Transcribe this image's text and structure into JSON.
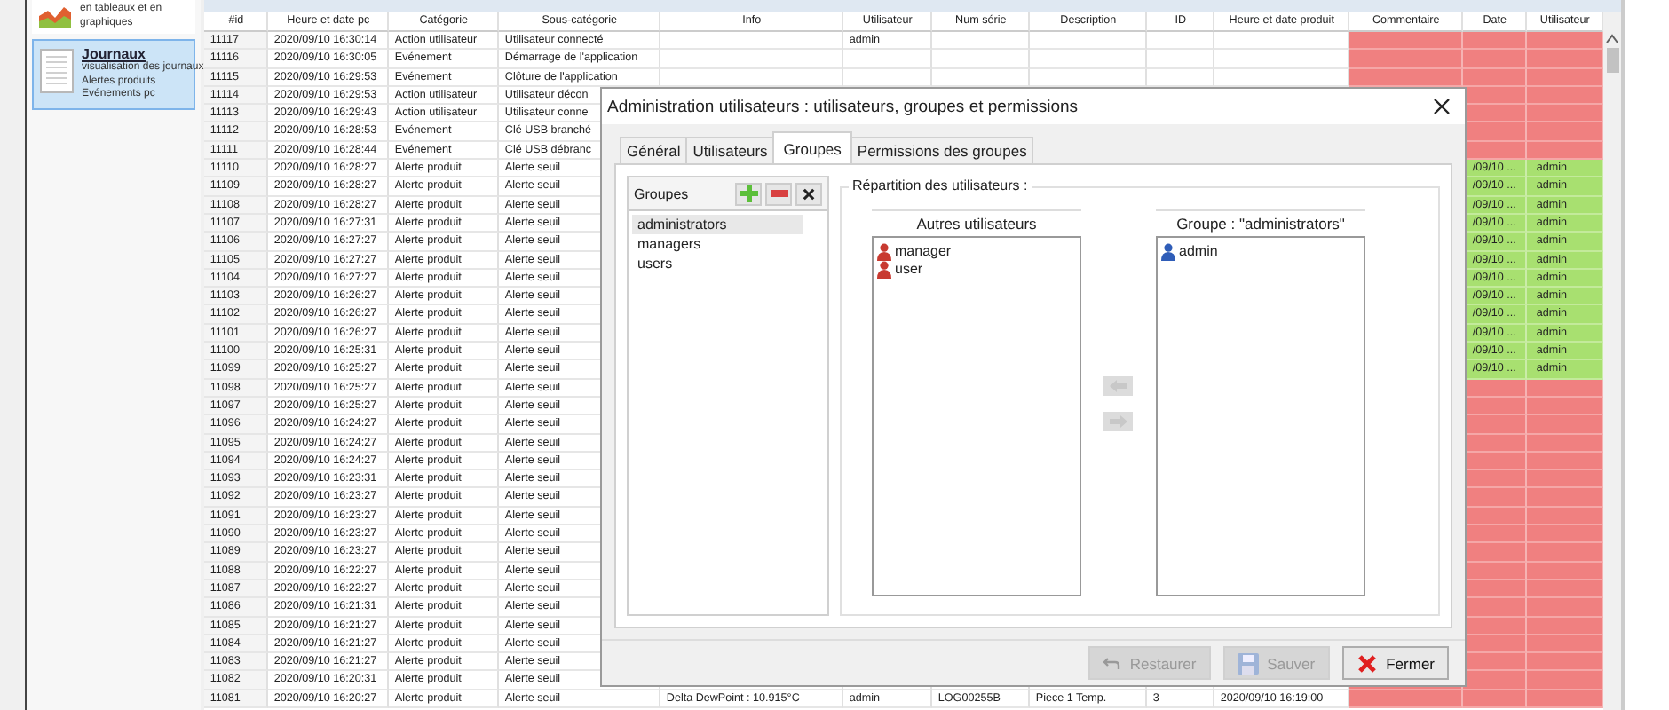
{
  "sidebar": {
    "items": [
      {
        "kind": "chart",
        "lines": [
          "en tableaux et en",
          "graphiques"
        ],
        "selected": false
      },
      {
        "kind": "log",
        "title": "Journaux",
        "lines": [
          "visualisation des journaux",
          "Alertes produits",
          "Evénements pc"
        ],
        "selected": true
      }
    ]
  },
  "table": {
    "columns": [
      "#id",
      "Heure et date pc",
      "Catégorie",
      "Sous-catégorie",
      "Info",
      "Utilisateur",
      "Num série",
      "Description",
      "ID",
      "Heure et date produit",
      "Commentaire",
      "Date",
      "Utilisateur"
    ],
    "rows": [
      {
        "cells": [
          "11117",
          "2020/09/10 16:30:14",
          "Action utilisateur",
          "Utilisateur connecté",
          null,
          "admin"
        ],
        "color": "#f08080"
      },
      {
        "cells": [
          "11116",
          "2020/09/10 16:30:05",
          "Evénement",
          "Démarrage de l'application"
        ],
        "color": "#f08080"
      },
      {
        "cells": [
          "11115",
          "2020/09/10 16:29:53",
          "Evénement",
          "Clôture de l'application"
        ],
        "color": "#f08080"
      },
      {
        "cells": [
          "11114",
          "2020/09/10 16:29:53",
          "Action utilisateur",
          "Utilisateur décon"
        ],
        "color": "#f08080"
      },
      {
        "cells": [
          "11113",
          "2020/09/10 16:29:43",
          "Action utilisateur",
          "Utilisateur conne"
        ],
        "color": "#f08080"
      },
      {
        "cells": [
          "11112",
          "2020/09/10 16:28:53",
          "Evénement",
          "Clé USB branché"
        ],
        "color": "#f08080"
      },
      {
        "cells": [
          "11111",
          "2020/09/10 16:28:44",
          "Evénement",
          "Clé USB débranc"
        ],
        "color": "#f08080"
      },
      {
        "cells": [
          "11110",
          "2020/09/10 16:28:27",
          "Alerte produit",
          "Alerte seuil",
          null,
          null,
          null,
          null,
          null,
          null,
          null,
          "/09/10 ...",
          "admin"
        ],
        "color": "#a8e070"
      },
      {
        "cells": [
          "11109",
          "2020/09/10 16:28:27",
          "Alerte produit",
          "Alerte seuil",
          null,
          null,
          null,
          null,
          null,
          null,
          null,
          "/09/10 ...",
          "admin"
        ],
        "color": "#a8e070"
      },
      {
        "cells": [
          "11108",
          "2020/09/10 16:28:27",
          "Alerte produit",
          "Alerte seuil",
          null,
          null,
          null,
          null,
          null,
          null,
          null,
          "/09/10 ...",
          "admin"
        ],
        "color": "#a8e070"
      },
      {
        "cells": [
          "11107",
          "2020/09/10 16:27:31",
          "Alerte produit",
          "Alerte seuil",
          null,
          null,
          null,
          null,
          null,
          null,
          null,
          "/09/10 ...",
          "admin"
        ],
        "color": "#a8e070"
      },
      {
        "cells": [
          "11106",
          "2020/09/10 16:27:27",
          "Alerte produit",
          "Alerte seuil",
          null,
          null,
          null,
          null,
          null,
          null,
          null,
          "/09/10 ...",
          "admin"
        ],
        "color": "#a8e070"
      },
      {
        "cells": [
          "11105",
          "2020/09/10 16:27:27",
          "Alerte produit",
          "Alerte seuil",
          null,
          null,
          null,
          null,
          null,
          null,
          null,
          "/09/10 ...",
          "admin"
        ],
        "color": "#a8e070"
      },
      {
        "cells": [
          "11104",
          "2020/09/10 16:27:27",
          "Alerte produit",
          "Alerte seuil",
          null,
          null,
          null,
          null,
          null,
          null,
          null,
          "/09/10 ...",
          "admin"
        ],
        "color": "#a8e070"
      },
      {
        "cells": [
          "11103",
          "2020/09/10 16:26:27",
          "Alerte produit",
          "Alerte seuil",
          null,
          null,
          null,
          null,
          null,
          null,
          null,
          "/09/10 ...",
          "admin"
        ],
        "color": "#a8e070"
      },
      {
        "cells": [
          "11102",
          "2020/09/10 16:26:27",
          "Alerte produit",
          "Alerte seuil",
          null,
          null,
          null,
          null,
          null,
          null,
          null,
          "/09/10 ...",
          "admin"
        ],
        "color": "#a8e070"
      },
      {
        "cells": [
          "11101",
          "2020/09/10 16:26:27",
          "Alerte produit",
          "Alerte seuil",
          null,
          null,
          null,
          null,
          null,
          null,
          null,
          "/09/10 ...",
          "admin"
        ],
        "color": "#a8e070"
      },
      {
        "cells": [
          "11100",
          "2020/09/10 16:25:31",
          "Alerte produit",
          "Alerte seuil",
          null,
          null,
          null,
          null,
          null,
          null,
          null,
          "/09/10 ...",
          "admin"
        ],
        "color": "#a8e070"
      },
      {
        "cells": [
          "11099",
          "2020/09/10 16:25:27",
          "Alerte produit",
          "Alerte seuil",
          null,
          null,
          null,
          null,
          null,
          null,
          null,
          "/09/10 ...",
          "admin"
        ],
        "color": "#a8e070"
      },
      {
        "cells": [
          "11098",
          "2020/09/10 16:25:27",
          "Alerte produit",
          "Alerte seuil"
        ],
        "color": "#f08080"
      },
      {
        "cells": [
          "11097",
          "2020/09/10 16:25:27",
          "Alerte produit",
          "Alerte seuil"
        ],
        "color": "#f08080"
      },
      {
        "cells": [
          "11096",
          "2020/09/10 16:24:27",
          "Alerte produit",
          "Alerte seuil"
        ],
        "color": "#f08080"
      },
      {
        "cells": [
          "11095",
          "2020/09/10 16:24:27",
          "Alerte produit",
          "Alerte seuil"
        ],
        "color": "#f08080"
      },
      {
        "cells": [
          "11094",
          "2020/09/10 16:24:27",
          "Alerte produit",
          "Alerte seuil"
        ],
        "color": "#f08080"
      },
      {
        "cells": [
          "11093",
          "2020/09/10 16:23:31",
          "Alerte produit",
          "Alerte seuil"
        ],
        "color": "#f08080"
      },
      {
        "cells": [
          "11092",
          "2020/09/10 16:23:27",
          "Alerte produit",
          "Alerte seuil"
        ],
        "color": "#f08080"
      },
      {
        "cells": [
          "11091",
          "2020/09/10 16:23:27",
          "Alerte produit",
          "Alerte seuil"
        ],
        "color": "#f08080"
      },
      {
        "cells": [
          "11090",
          "2020/09/10 16:23:27",
          "Alerte produit",
          "Alerte seuil"
        ],
        "color": "#f08080"
      },
      {
        "cells": [
          "11089",
          "2020/09/10 16:23:27",
          "Alerte produit",
          "Alerte seuil"
        ],
        "color": "#f08080"
      },
      {
        "cells": [
          "11088",
          "2020/09/10 16:22:27",
          "Alerte produit",
          "Alerte seuil"
        ],
        "color": "#f08080"
      },
      {
        "cells": [
          "11087",
          "2020/09/10 16:22:27",
          "Alerte produit",
          "Alerte seuil"
        ],
        "color": "#f08080"
      },
      {
        "cells": [
          "11086",
          "2020/09/10 16:21:31",
          "Alerte produit",
          "Alerte seuil"
        ],
        "color": "#f08080"
      },
      {
        "cells": [
          "11085",
          "2020/09/10 16:21:27",
          "Alerte produit",
          "Alerte seuil"
        ],
        "color": "#f08080"
      },
      {
        "cells": [
          "11084",
          "2020/09/10 16:21:27",
          "Alerte produit",
          "Alerte seuil"
        ],
        "color": "#f08080"
      },
      {
        "cells": [
          "11083",
          "2020/09/10 16:21:27",
          "Alerte produit",
          "Alerte seuil"
        ],
        "color": "#f08080"
      },
      {
        "cells": [
          "11082",
          "2020/09/10 16:20:31",
          "Alerte produit",
          "Alerte seuil"
        ],
        "color": "#f08080"
      },
      {
        "cells": [
          "11081",
          "2020/09/10 16:20:27",
          "Alerte produit",
          "Alerte seuil",
          "Delta DewPoint : 10.915°C",
          "admin",
          "LOG00255B",
          "Piece 1 Temp.",
          "3",
          "2020/09/10 16:19:00"
        ],
        "color": "#f08080"
      }
    ]
  },
  "dialog": {
    "title": "Administration utilisateurs : utilisateurs, groupes et permissions",
    "tabs": [
      {
        "label": "Général",
        "selected": false
      },
      {
        "label": "Utilisateurs",
        "selected": false
      },
      {
        "label": "Groupes",
        "selected": true
      },
      {
        "label": "Permissions des groupes",
        "selected": false
      }
    ],
    "groups_panel": {
      "title": "Groupes",
      "items": [
        {
          "label": "administrators",
          "selected": true
        },
        {
          "label": "managers",
          "selected": false
        },
        {
          "label": "users",
          "selected": false
        }
      ]
    },
    "distribution": {
      "title": "Répartition des utilisateurs :",
      "other_users": {
        "title": "Autres utilisateurs",
        "items": [
          "manager",
          "user"
        ]
      },
      "group_members": {
        "title": "Groupe : \"administrators\"",
        "items": [
          "admin"
        ]
      },
      "move_buttons": [
        {
          "kind": "left",
          "disabled": true
        },
        {
          "kind": "right",
          "disabled": true
        }
      ]
    },
    "buttons": [
      {
        "kind": "restore",
        "label": "Restaurer",
        "disabled": true
      },
      {
        "kind": "save",
        "label": "Sauver",
        "disabled": true
      },
      {
        "kind": "close",
        "label": "Fermer",
        "disabled": false
      }
    ]
  }
}
